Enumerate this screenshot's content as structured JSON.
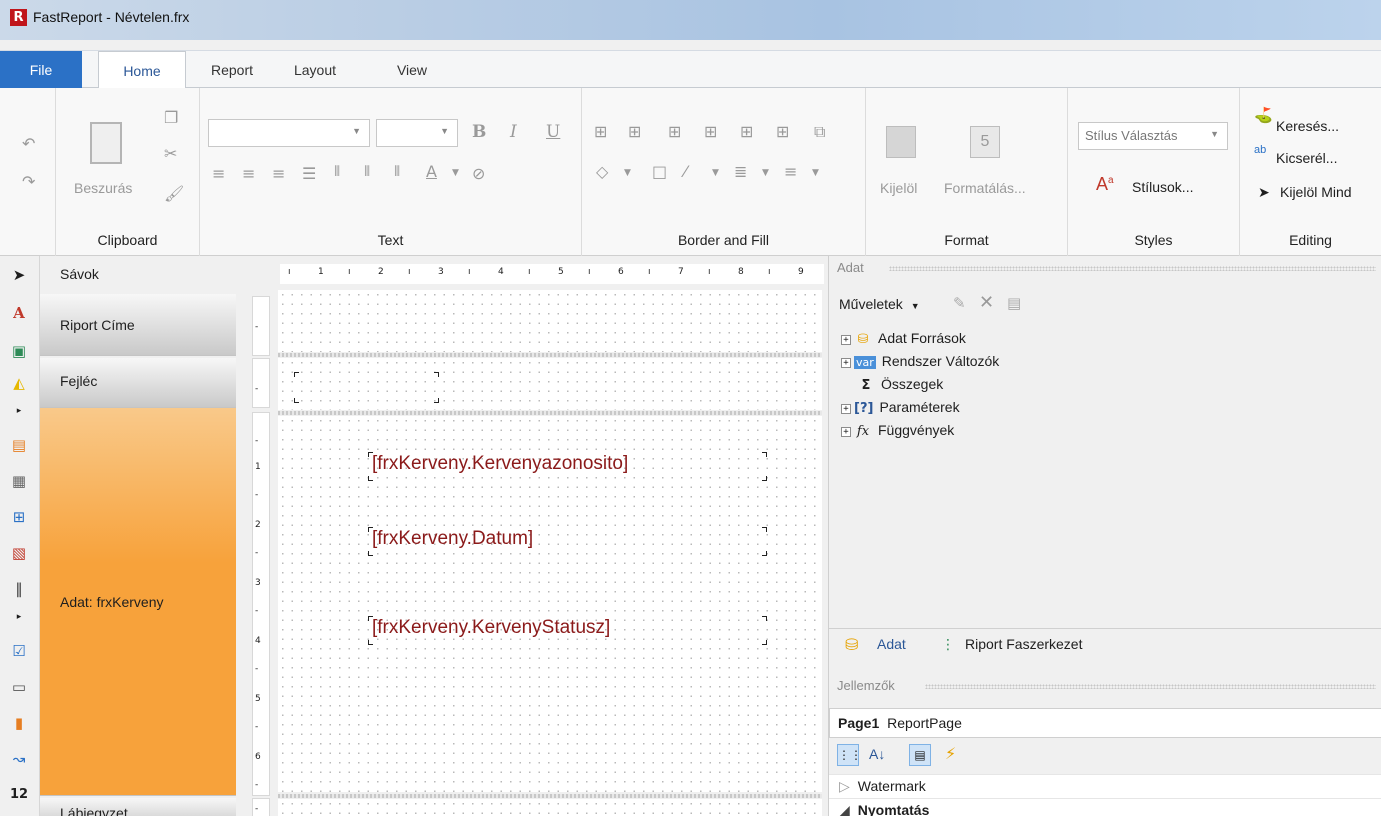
{
  "window": {
    "title": "FastReport - Névtelen.frx"
  },
  "ribbon": {
    "tabs": [
      "File",
      "Home",
      "Report",
      "Layout",
      "View"
    ],
    "active_tab": "Home",
    "groups": {
      "clipboard": {
        "label": "Clipboard",
        "paste_label": "Beszurás"
      },
      "text": {
        "label": "Text"
      },
      "border_fill": {
        "label": "Border and Fill"
      },
      "format": {
        "label": "Format",
        "select_label": "Kijelöl",
        "format_label": "Formatálás..."
      },
      "styles": {
        "label": "Styles",
        "combo_value": "Stílus Választás",
        "styles_label": "Stílusok..."
      },
      "editing": {
        "label": "Editing",
        "find": "Keresés...",
        "replace": "Kicserél...",
        "select_all": "Kijelöl Mind"
      }
    }
  },
  "bands_panel": {
    "header": "Sávok",
    "bands": [
      "Riport Címe",
      "Fejléc",
      "Adat: frxKerveny",
      "Lábjegyzet"
    ]
  },
  "ruler": {
    "h_numbers": [
      "1",
      "2",
      "3",
      "4",
      "5",
      "6",
      "7",
      "8",
      "9"
    ],
    "v_numbers": [
      "1",
      "2",
      "3",
      "4",
      "5",
      "6"
    ]
  },
  "design": {
    "fields": [
      "[frxKerveny.Kervenyazonosito]",
      "[frxKerveny.Datum]",
      "[frxKerveny.KervenyStatusz]"
    ]
  },
  "data_panel": {
    "header": "Adat",
    "actions_label": "Műveletek",
    "tree": [
      {
        "icon": "database-icon",
        "label": "Adat Források"
      },
      {
        "icon": "var",
        "label": "Rendszer Változók"
      },
      {
        "icon": "Σ",
        "label": "Összegek"
      },
      {
        "icon": "[?]",
        "label": "Paraméterek"
      },
      {
        "icon": "fx",
        "label": "Függvények"
      }
    ],
    "tabs": [
      "Adat",
      "Riport Faszerkezet"
    ]
  },
  "properties_panel": {
    "header": "Jellemzők",
    "object_name": "Page1",
    "object_type": "ReportPage",
    "rows": [
      "Watermark",
      "Nyomtatás"
    ]
  }
}
